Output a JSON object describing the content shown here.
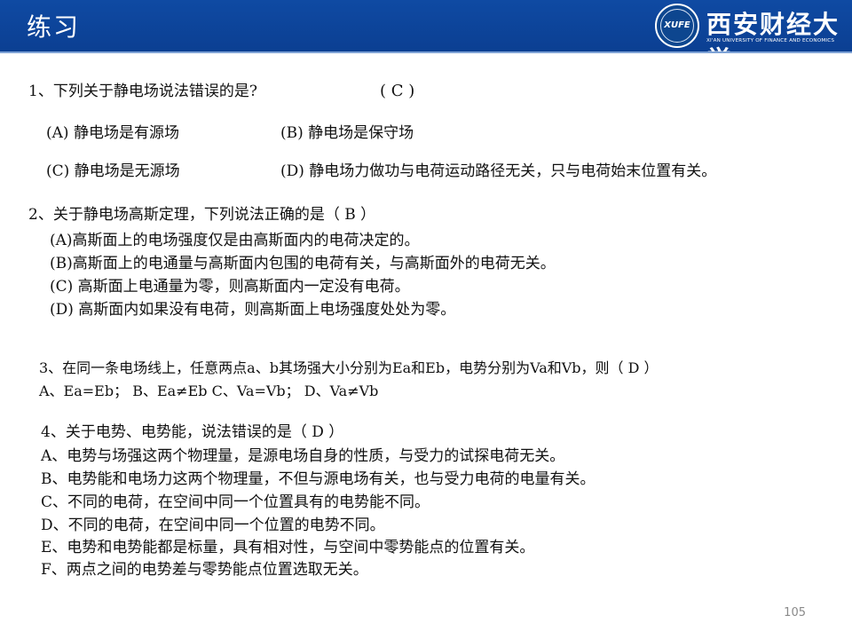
{
  "header": {
    "title": "练习",
    "logo_seal_text": "XUFE",
    "logo_cn": "西安财经大学",
    "logo_en": "XI'AN UNIVERSITY OF FINANCE AND ECONOMICS"
  },
  "q1": {
    "stem": "1、下列关于静电场说法错误的是?",
    "answer": "( C )",
    "optA": "(A)   静电场是有源场",
    "optB": "(B)   静电场是保守场",
    "optC": "(C)   静电场是无源场",
    "optD": "(D) 静电场力做功与电荷运动路径无关，只与电荷始末位置有关。"
  },
  "q2": {
    "stem": "2、关于静电场高斯定理，下列说法正确的是（   B  ）",
    "optA": "(A)高斯面上的电场强度仅是由高斯面内的电荷决定的。",
    "optB": "(B)高斯面上的电通量与高斯面内包围的电荷有关，与高斯面外的电荷无关。",
    "optC": "(C) 高斯面上电通量为零，则高斯面内一定没有电荷。",
    "optD": "(D) 高斯面内如果没有电荷，则高斯面上电场强度处处为零。"
  },
  "q3": {
    "stem": "3、在同一条电场线上，任意两点a、b其场强大小分别为Ea和Eb，电势分别为Va和Vb，则（  D ）",
    "options": "A、Ea=Eb；    B、Ea≠Eb    C、Va=Vb；    D、Va≠Vb"
  },
  "q4": {
    "stem": "4、关于电势、电势能，说法错误的是（  D ）",
    "items": [
      "A、电势与场强这两个物理量，是源电场自身的性质，与受力的试探电荷无关。",
      "B、电势能和电场力这两个物理量，不但与源电场有关，也与受力电荷的电量有关。",
      "C、不同的电荷，在空间中同一个位置具有的电势能不同。",
      "D、不同的电荷，在空间中同一个位置的电势不同。",
      "E、电势和电势能都是标量，具有相对性，与空间中零势能点的位置有关。",
      "F、两点之间的电势差与零势能点位置选取无关。"
    ]
  },
  "page_number": "105"
}
